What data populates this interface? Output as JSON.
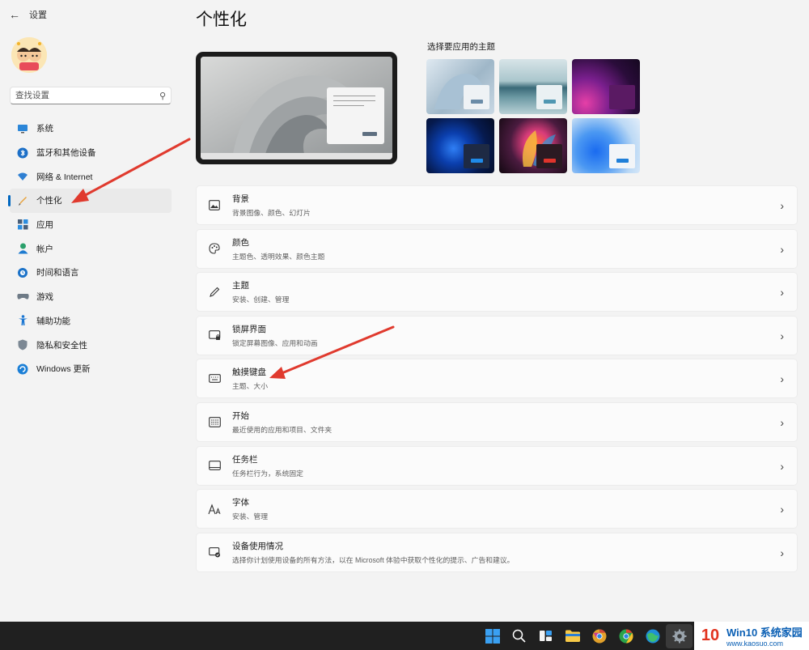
{
  "window": {
    "back_glyph": "←",
    "title": "设置"
  },
  "sidebar": {
    "search_placeholder": "查找设置",
    "items": [
      {
        "label": "系统",
        "icon": "monitor-icon"
      },
      {
        "label": "蓝牙和其他设备",
        "icon": "bluetooth-icon"
      },
      {
        "label": "网络 & Internet",
        "icon": "wifi-icon"
      },
      {
        "label": "个性化",
        "icon": "brush-icon",
        "active": true
      },
      {
        "label": "应用",
        "icon": "apps-icon"
      },
      {
        "label": "帐户",
        "icon": "account-icon"
      },
      {
        "label": "时间和语言",
        "icon": "globe-clock-icon"
      },
      {
        "label": "游戏",
        "icon": "gamepad-icon"
      },
      {
        "label": "辅助功能",
        "icon": "accessibility-icon"
      },
      {
        "label": "隐私和安全性",
        "icon": "shield-icon"
      },
      {
        "label": "Windows 更新",
        "icon": "update-icon"
      }
    ]
  },
  "main": {
    "title": "个性化",
    "themes_label": "选择要应用的主题",
    "settings": [
      {
        "title": "背景",
        "subtitle": "背景图像、颜色、幻灯片",
        "icon": "image-icon"
      },
      {
        "title": "颜色",
        "subtitle": "主题色、透明效果、颜色主题",
        "icon": "palette-icon"
      },
      {
        "title": "主题",
        "subtitle": "安装、创建、管理",
        "icon": "pen-icon"
      },
      {
        "title": "锁屏界面",
        "subtitle": "锁定屏幕图像、应用和动画",
        "icon": "lock-screen-icon"
      },
      {
        "title": "触摸键盘",
        "subtitle": "主题、大小",
        "icon": "keyboard-icon"
      },
      {
        "title": "开始",
        "subtitle": "最近使用的应用和项目、文件夹",
        "icon": "start-menu-icon"
      },
      {
        "title": "任务栏",
        "subtitle": "任务栏行为，系统固定",
        "icon": "taskbar-icon"
      },
      {
        "title": "字体",
        "subtitle": "安装、管理",
        "icon": "font-icon"
      },
      {
        "title": "设备使用情况",
        "subtitle": "选择你计划使用设备的所有方法，以在 Microsoft 体验中获取个性化的提示、广告和建议。",
        "icon": "device-usage-icon"
      }
    ]
  },
  "colors": {
    "accent": "#0067c0",
    "arrow": "#e03a2e",
    "taskbar": "#202020"
  },
  "watermark": {
    "logo": "10",
    "line1": "Win10 系统家园",
    "line2": "www.kaosuo.com"
  }
}
